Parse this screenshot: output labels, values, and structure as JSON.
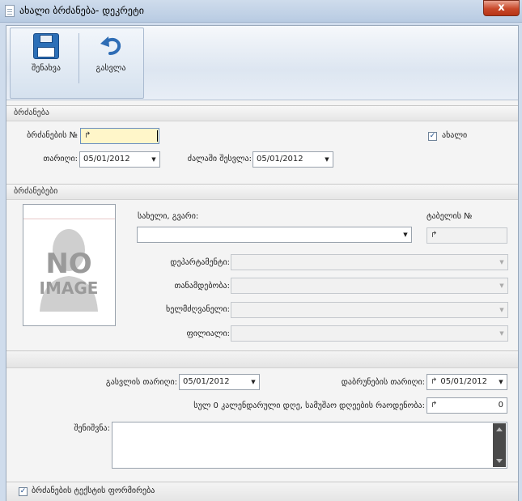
{
  "window": {
    "title": "ახალი ბრძანება- დეკრეტი",
    "close_label": "x"
  },
  "ribbon": {
    "save_label": "შენახვა",
    "exit_label": "გასვლა"
  },
  "order_section": {
    "header": "ბრძანება",
    "order_no_label": "ბრძანების №",
    "order_no_value": "↱",
    "new_label": "ახალი",
    "new_checked": true,
    "date_label": "თარიღი:",
    "date_value": "05/01/2012",
    "entry_date_label": "ძალაში შესვლა:",
    "entry_date_value": "05/01/2012"
  },
  "orders_section": {
    "header": "ბრძანებები",
    "photo_text": [
      "NO",
      "IMAGE"
    ],
    "name_label": "სახელი, გვარი:",
    "name_value": "",
    "tabel_label": "ტაბელის №",
    "tabel_value": "↱",
    "department_label": "დეპარტამენტი:",
    "position_label": "თანამდებობა:",
    "manager_label": "ხელმძღვანელი:",
    "branch_label": "ფილიალი:"
  },
  "leave_section": {
    "leave_date_label": "გასვლის თარიღი:",
    "leave_date_value": "05/01/2012",
    "return_date_label": "დაბრუნების თარიღი:",
    "return_date_value": "05/01/2012",
    "days_label": "სულ 0 კალენდარული დღე, სამუშაო დღეების რაოდენობა:",
    "days_spin": "↱",
    "days_value": "0",
    "note_label": "შენიშვნა:"
  },
  "footer": {
    "generate_label": "ბრძანების ტექსტის ფორმირება",
    "generate_checked": true
  },
  "colors": {
    "accent": "#2c6fb7",
    "focus_bg": "#fff6c9"
  }
}
